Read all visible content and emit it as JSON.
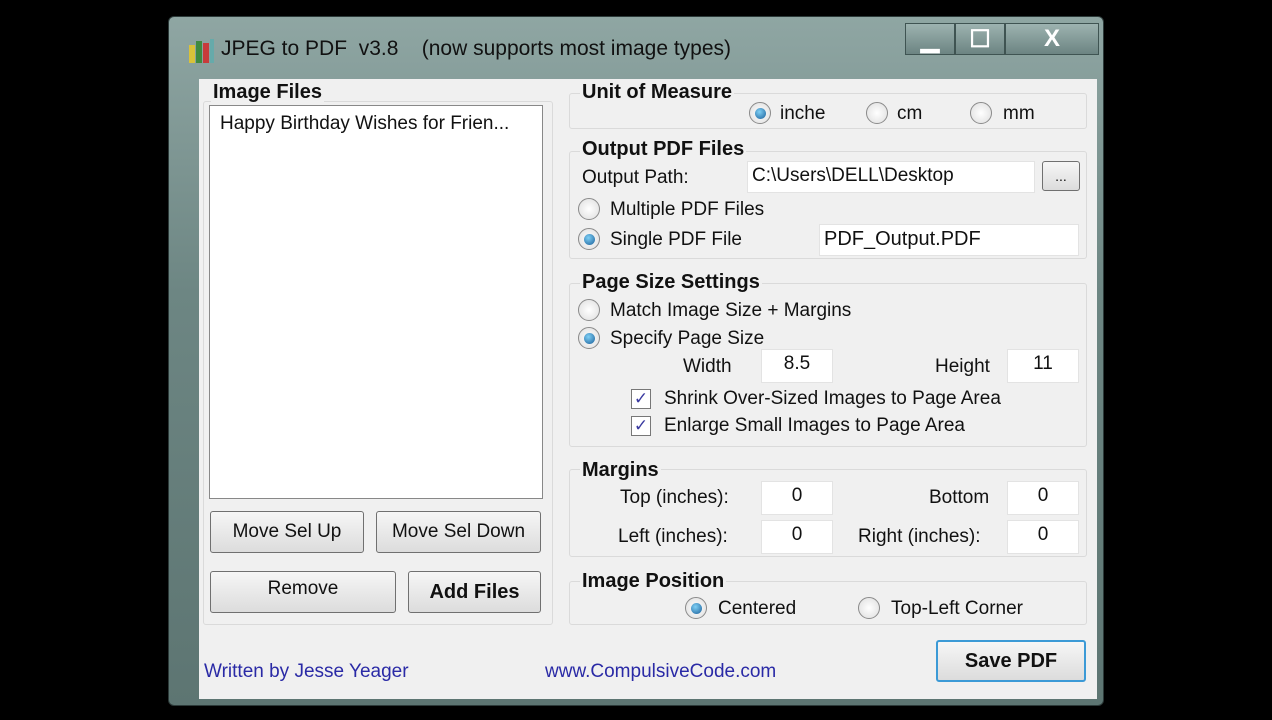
{
  "window": {
    "title": "JPEG to PDF  v3.8    (now supports most image types)"
  },
  "image_files": {
    "label": "Image Files",
    "items": [
      "Happy Birthday Wishes for Frien..."
    ],
    "move_up": "Move Sel Up",
    "move_down": "Move Sel Down",
    "remove": "Remove",
    "add": "Add Files"
  },
  "unit": {
    "label": "Unit of Measure",
    "options": [
      "inche",
      "cm",
      "mm"
    ],
    "selected": "inche"
  },
  "output": {
    "label": "Output PDF Files",
    "path_label": "Output Path:",
    "path": "C:\\Users\\DELL\\Desktop",
    "browse": "...",
    "multiple": "Multiple PDF Files",
    "single": "Single PDF File",
    "filename": "PDF_Output.PDF",
    "selected": "single"
  },
  "page_size": {
    "label": "Page Size Settings",
    "match": "Match Image Size + Margins",
    "specify": "Specify Page Size",
    "width_label": "Width",
    "width": "8.5",
    "height_label": "Height",
    "height": "11",
    "shrink": "Shrink Over-Sized Images to Page Area",
    "enlarge": "Enlarge Small Images to Page Area",
    "shrink_checked": true,
    "enlarge_checked": true
  },
  "margins": {
    "label": "Margins",
    "top_label": "Top (inches):",
    "top": "0",
    "bottom_label": "Bottom",
    "bottom": "0",
    "left_label": "Left (inches):",
    "left": "0",
    "right_label": "Right (inches):",
    "right": "0"
  },
  "position": {
    "label": "Image Position",
    "centered": "Centered",
    "topleft": "Top-Left Corner",
    "selected": "centered"
  },
  "footer": {
    "author": "Written by Jesse Yeager",
    "site": "www.CompulsiveCode.com",
    "save": "Save PDF"
  }
}
